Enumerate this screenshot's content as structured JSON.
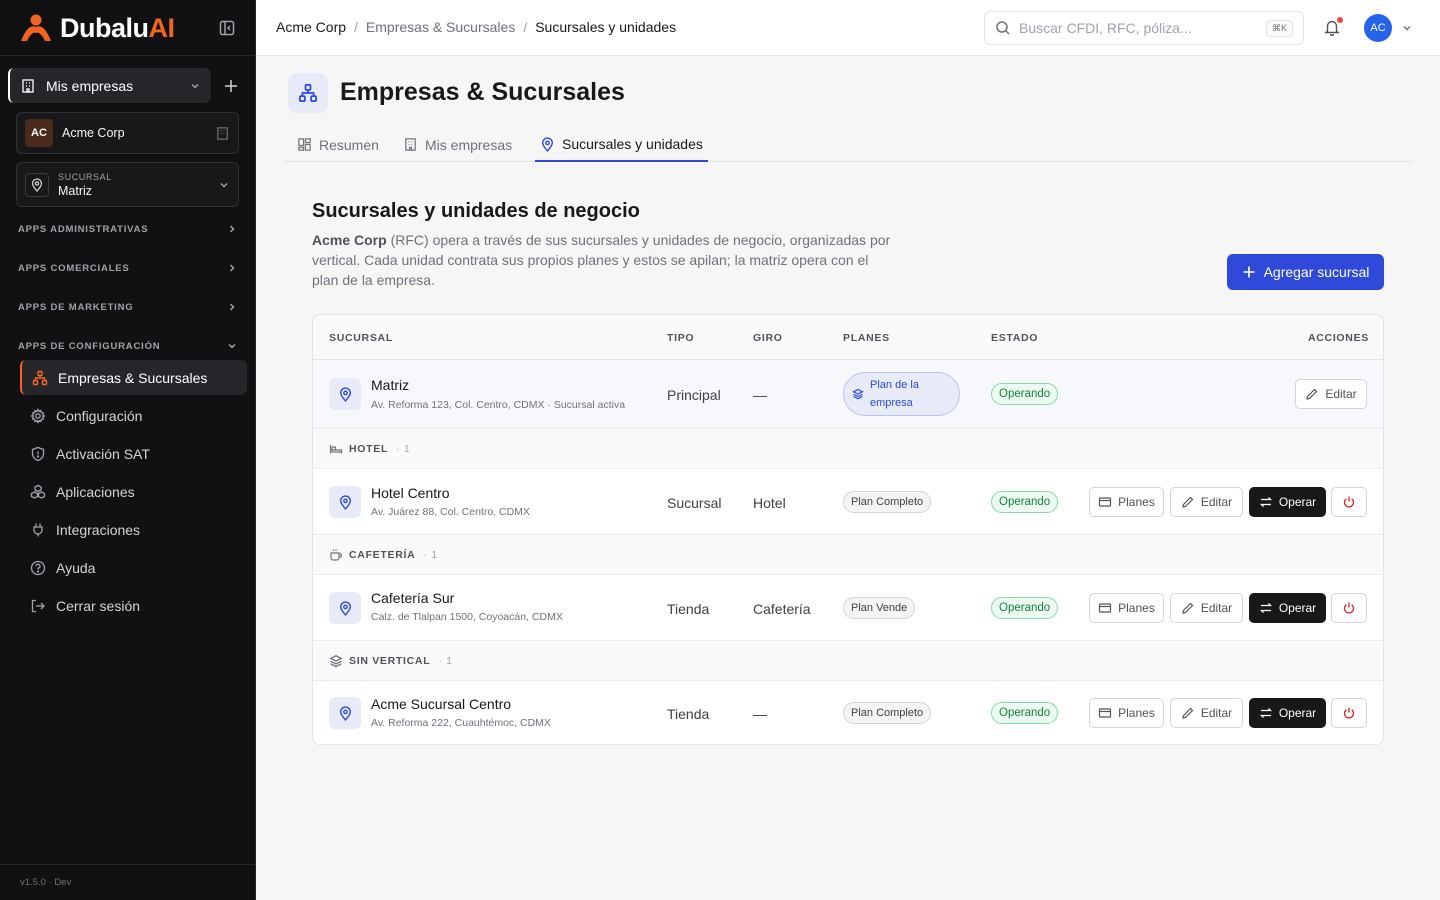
{
  "brand": {
    "name_main": "Dubalu",
    "name_accent": "AI",
    "accent_color": "#f2651f"
  },
  "sidebar": {
    "companies_selector": "Mis empresas",
    "company": {
      "initials": "AC",
      "name": "Acme Corp"
    },
    "branch": {
      "caption": "SUCURSAL",
      "value": "Matriz"
    },
    "sections": [
      {
        "label": "APPS ADMINISTRATIVAS"
      },
      {
        "label": "APPS COMERCIALES"
      },
      {
        "label": "APPS DE MARKETING"
      },
      {
        "label": "APPS DE CONFIGURACIÓN"
      }
    ],
    "items": [
      {
        "label": "Empresas & Sucursales"
      },
      {
        "label": "Configuración"
      },
      {
        "label": "Activación SAT"
      },
      {
        "label": "Aplicaciones"
      },
      {
        "label": "Integraciones"
      },
      {
        "label": "Ayuda"
      },
      {
        "label": "Cerrar sesión"
      }
    ],
    "version": "v1.5.0 · Dev"
  },
  "header": {
    "breadcrumb": [
      "Acme Corp",
      "Empresas & Sucursales",
      "Sucursales y unidades"
    ],
    "breadcrumb_sep": "/",
    "search_placeholder": "Buscar CFDI, RFC, póliza...",
    "search_shortcut": "⌘K",
    "user_initials": "AC"
  },
  "page": {
    "title": "Empresas & Sucursales",
    "tabs": [
      {
        "label": "Resumen"
      },
      {
        "label": "Mis empresas"
      },
      {
        "label": "Sucursales y unidades"
      }
    ],
    "section_title": "Sucursales y unidades de negocio",
    "desc_company": "Acme Corp",
    "desc_text": " (RFC) opera a través de sus sucursales y unidades de negocio, organizadas por vertical. Cada unidad contrata sus propios planes y estos se apilan; la matriz opera con el plan de la empresa.",
    "add_button": "Agregar sucursal"
  },
  "table": {
    "columns": [
      "SUCURSAL",
      "TIPO",
      "GIRO",
      "PLANES",
      "ESTADO",
      "ACCIONES"
    ],
    "matriz": {
      "name": "Matriz",
      "address": "Av. Reforma 123, Col. Centro, CDMX · Sucursal activa",
      "tipo": "Principal",
      "giro": "—",
      "plan_line1": "Plan de la",
      "plan_line2": "empresa",
      "status": "Operando",
      "edit": "Editar"
    },
    "groups": [
      {
        "label": "HOTEL",
        "count": "· 1",
        "row": {
          "name": "Hotel Centro",
          "address": "Av. Juárez 88, Col. Centro, CDMX",
          "tipo": "Sucursal",
          "giro": "Hotel",
          "plan": "Plan Completo",
          "status": "Operando"
        }
      },
      {
        "label": "CAFETERÍA",
        "count": "· 1",
        "row": {
          "name": "Cafetería Sur",
          "address": "Calz. de Tlalpan 1500, Coyoacán, CDMX",
          "tipo": "Tienda",
          "giro": "Cafetería",
          "plan": "Plan Vende",
          "status": "Operando"
        }
      },
      {
        "label": "SIN VERTICAL",
        "count": "· 1",
        "row": {
          "name": "Acme Sucursal Centro",
          "address": "Av. Reforma 222, Cuauhtémoc, CDMX",
          "tipo": "Tienda",
          "giro": "—",
          "plan": "Plan Completo",
          "status": "Operando"
        }
      }
    ],
    "actions": {
      "plans": "Planes",
      "edit": "Editar",
      "operate": "Operar"
    }
  }
}
